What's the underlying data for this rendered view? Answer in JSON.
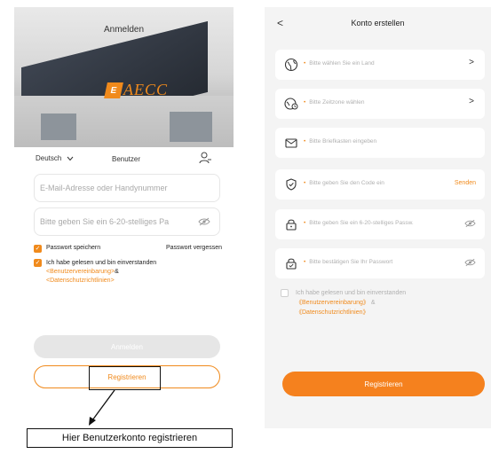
{
  "left_screen": {
    "title": "Anmelden",
    "brand": {
      "mark": "E",
      "name": "AECC"
    },
    "language": "Deutsch",
    "tab_user": "Benutzer",
    "email_placeholder": "E-Mail-Adresse oder Handynummer",
    "password_placeholder": "Bitte geben Sie ein 6-20-stelliges Pa",
    "save_password": "Passwort speichern",
    "forgot_password": "Passwort vergessen",
    "agree_text": "Ich habe gelesen und bin einverstanden",
    "agreement_link": "<Benutzervereinbarung>",
    "ampersand": "&",
    "privacy_link": "<Datenschutzrichtlinien>",
    "login_button": "Anmelden",
    "register_button": "Registrieren",
    "annotation": "Hier Benutzerkonto registrieren"
  },
  "right_screen": {
    "title": "Konto erstellen",
    "back": "<",
    "rows": [
      {
        "text": "Bitte wählen Sie ein Land",
        "icon": "globe-icon"
      },
      {
        "text": "Bitte Zeitzone wählen",
        "icon": "timezone-icon"
      },
      {
        "text": "Bitte Briefkasten eingeben",
        "icon": "mail-icon"
      },
      {
        "text": "Bitte geben Sie den Code ein",
        "icon": "shield-icon",
        "action": "Senden"
      },
      {
        "text": "Bitte geben Sie ein 6-20-stelliges Passw.",
        "icon": "lock-icon"
      },
      {
        "text": "Bitte bestätigen Sie Ihr Passwort",
        "icon": "lock-check-icon"
      }
    ],
    "agree_text": "Ich habe gelesen und bin einverstanden",
    "agreement_link": "《Benutzervereinbarung》",
    "ampersand": "&",
    "privacy_link": "《Datenschutzrichtlinien》",
    "register_button": "Registrieren"
  },
  "colors": {
    "accent": "#f08a1c",
    "disabled": "#e6e6e6",
    "placeholder": "#a9a9a9"
  }
}
